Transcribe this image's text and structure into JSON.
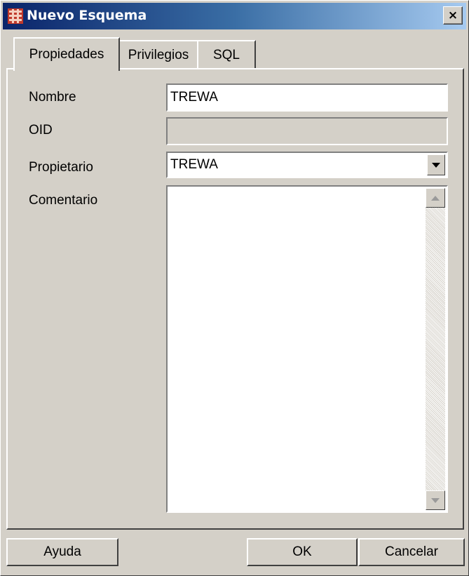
{
  "window": {
    "title": "Nuevo Esquema",
    "close_label": "×"
  },
  "tabs": [
    {
      "label": "Propiedades",
      "active": true
    },
    {
      "label": "Privilegios",
      "active": false
    },
    {
      "label": "SQL",
      "active": false
    }
  ],
  "form": {
    "nombre": {
      "label": "Nombre",
      "value": "TREWA"
    },
    "oid": {
      "label": "OID",
      "value": ""
    },
    "propietario": {
      "label": "Propietario",
      "value": "TREWA"
    },
    "comentario": {
      "label": "Comentario",
      "value": ""
    }
  },
  "buttons": {
    "help": "Ayuda",
    "ok": "OK",
    "cancel": "Cancelar"
  },
  "icons": {
    "app": "schema-app-icon",
    "close": "close-icon",
    "dropdown": "chevron-down-icon",
    "scroll_up": "scroll-up-arrow-icon",
    "scroll_down": "scroll-down-arrow-icon"
  }
}
